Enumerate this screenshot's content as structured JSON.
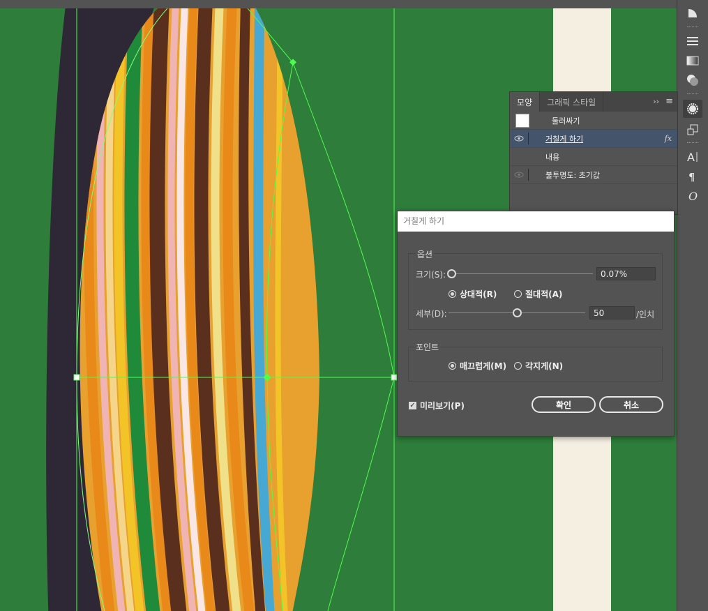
{
  "appearance_panel": {
    "tabs": [
      "모양",
      "그래픽 스타일"
    ],
    "more_label": "››",
    "rows": {
      "stroke": "둘러싸기",
      "roughen": "거칠게 하기",
      "fx": "fx",
      "content": "내용",
      "opacity": "불투명도: 초기값"
    }
  },
  "roughen_dialog": {
    "title": "거칠게 하기",
    "options_legend": "옵션",
    "size_label": "크기(S):",
    "size_value": "0.07%",
    "size_slider_fraction": 0.0,
    "relative_label": "상대적(R)",
    "absolute_label": "절대적(A)",
    "size_mode": "relative",
    "detail_label": "세부(D):",
    "detail_value": "50",
    "detail_unit": "/인치",
    "detail_slider_fraction": 0.5,
    "points_legend": "포인트",
    "smooth_label": "매끄럽게(M)",
    "corner_label": "각지게(N)",
    "points_mode": "smooth",
    "preview_label": "미리보기(P)",
    "preview_checked": true,
    "ok_label": "확인",
    "cancel_label": "취소"
  },
  "colors": {
    "background_green": "#2e7d3a",
    "ui_gray": "#535353",
    "selection_green": "#4cff4c",
    "dark_stripe": "#2e2836",
    "orange": "#e8a02f"
  },
  "right_toolbar_icons": [
    "image-trace-icon",
    "align-icon",
    "gradient-icon",
    "transparency-icon",
    "appearance-icon",
    "transform-icon",
    "character-icon",
    "paragraph-icon",
    "opentype-icon"
  ]
}
